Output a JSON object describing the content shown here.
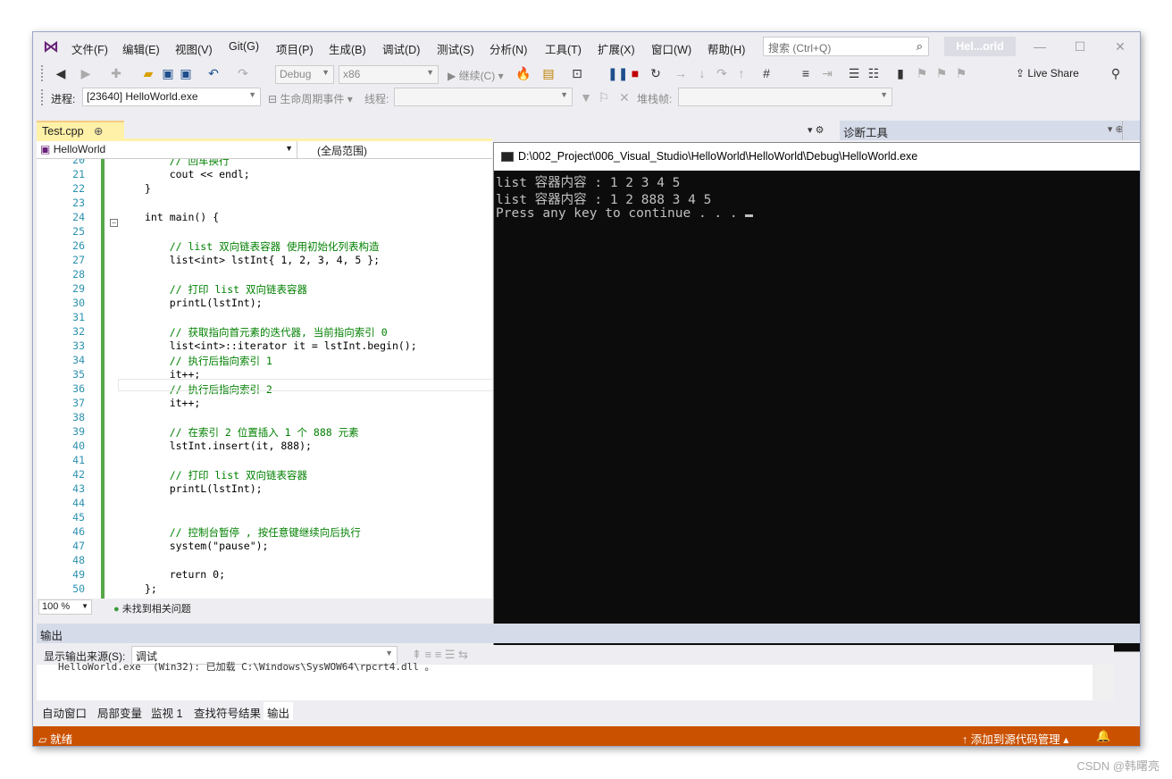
{
  "menubar": {
    "items": [
      "文件(F)",
      "编辑(E)",
      "视图(V)",
      "Git(G)",
      "项目(P)",
      "生成(B)",
      "调试(D)",
      "测试(S)",
      "分析(N)",
      "工具(T)",
      "扩展(X)",
      "窗口(W)",
      "帮助(H)"
    ],
    "search_placeholder": "搜索 (Ctrl+Q)",
    "solution_name": "Hel...orld"
  },
  "toolbar": {
    "config": "Debug",
    "platform": "x86",
    "continue_label": "继续(C)",
    "live_share": "Live Share"
  },
  "debugbar": {
    "process_label": "进程:",
    "process_value": "[23640] HelloWorld.exe",
    "lifecycle_label": "生命周期事件",
    "thread_label": "线程:",
    "stackframe_label": "堆栈帧:"
  },
  "editor": {
    "tab_name": "Test.cpp",
    "tab_pin": "⊕",
    "tab_close": "✕",
    "nav_project": "HelloWorld",
    "nav_scope": "(全局范围)",
    "zoom": "100 %",
    "issues": "未找到相关问题",
    "lines": [
      {
        "n": "20",
        "t": "    // 回车换行"
      },
      {
        "n": "21",
        "t": "    cout << endl;"
      },
      {
        "n": "22",
        "t": "}"
      },
      {
        "n": "23",
        "t": ""
      },
      {
        "n": "24",
        "t": "int main() {"
      },
      {
        "n": "25",
        "t": ""
      },
      {
        "n": "26",
        "t": "    // list 双向链表容器 使用初始化列表构造"
      },
      {
        "n": "27",
        "t": "    list<int> lstInt{ 1, 2, 3, 4, 5 };"
      },
      {
        "n": "28",
        "t": ""
      },
      {
        "n": "29",
        "t": "    // 打印 list 双向链表容器"
      },
      {
        "n": "30",
        "t": "    printL(lstInt);"
      },
      {
        "n": "31",
        "t": ""
      },
      {
        "n": "32",
        "t": "    // 获取指向首元素的迭代器, 当前指向索引 0"
      },
      {
        "n": "33",
        "t": "    list<int>::iterator it = lstInt.begin();"
      },
      {
        "n": "34",
        "t": "    // 执行后指向索引 1"
      },
      {
        "n": "35",
        "t": "    it++;"
      },
      {
        "n": "36",
        "t": "    // 执行后指向索引 2"
      },
      {
        "n": "37",
        "t": "    it++;"
      },
      {
        "n": "38",
        "t": ""
      },
      {
        "n": "39",
        "t": "    // 在索引 2 位置插入 1 个 888 元素"
      },
      {
        "n": "40",
        "t": "    lstInt.insert(it, 888);"
      },
      {
        "n": "41",
        "t": ""
      },
      {
        "n": "42",
        "t": "    // 打印 list 双向链表容器"
      },
      {
        "n": "43",
        "t": "    printL(lstInt);"
      },
      {
        "n": "44",
        "t": ""
      },
      {
        "n": "45",
        "t": ""
      },
      {
        "n": "46",
        "t": "    // 控制台暂停 , 按任意键继续向后执行"
      },
      {
        "n": "47",
        "t": "    system(\"pause\");"
      },
      {
        "n": "48",
        "t": ""
      },
      {
        "n": "49",
        "t": "    return 0;"
      },
      {
        "n": "50",
        "t": "};"
      }
    ]
  },
  "console": {
    "title": "D:\\002_Project\\006_Visual_Studio\\HelloWorld\\HelloWorld\\Debug\\HelloWorld.exe",
    "lines": [
      "list 容器内容 : 1 2 3 4 5",
      "list 容器内容 : 1 2 888 3 4 5",
      "Press any key to continue . . ."
    ]
  },
  "diagnostics": {
    "title": "诊断工具"
  },
  "output": {
    "header": "输出",
    "source_label": "显示输出来源(S):",
    "source_value": "调试",
    "text": "HelloWorld.exe  (Win32): 已加载 C:\\Windows\\SysWOW64\\rpcrt4.dll 。"
  },
  "bottom_tabs": [
    "自动窗口",
    "局部变量",
    "监视 1",
    "查找符号结果",
    "输出"
  ],
  "status": {
    "ready": "就绪",
    "source_control": "添加到源代码管理"
  },
  "watermark": "CSDN @韩曙亮"
}
